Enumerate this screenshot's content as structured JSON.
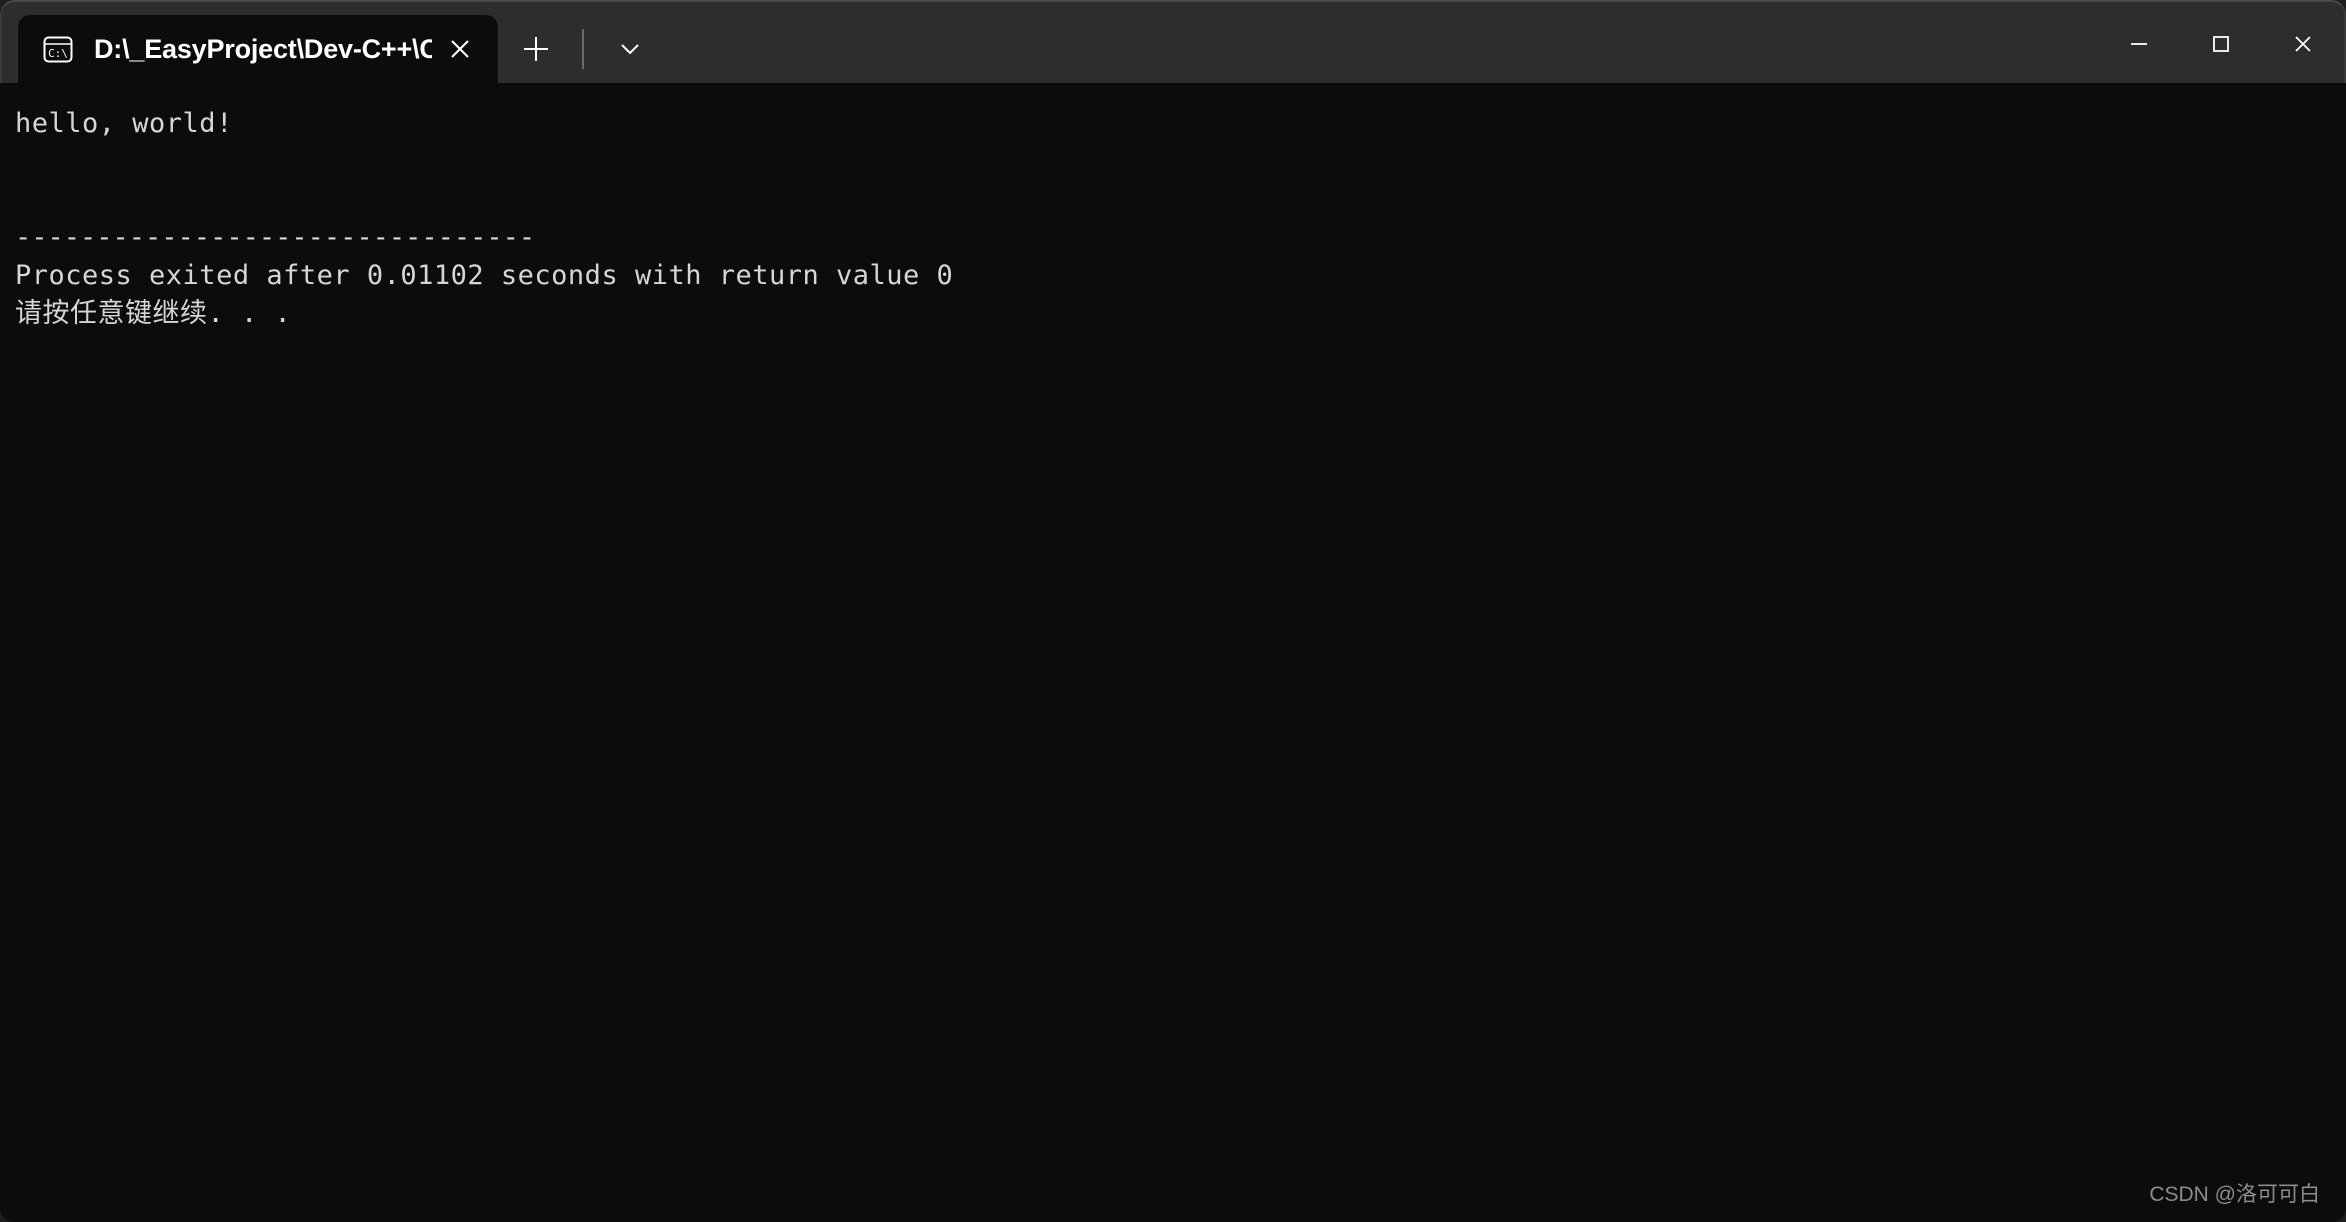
{
  "window": {
    "titlebar_color": "#2d2d2d",
    "body_color": "#0c0c0c",
    "text_color": "#d6d6d6"
  },
  "tabs": [
    {
      "title": "D:\\_EasyProject\\Dev-C++\\Cor",
      "icon": "command-prompt-icon",
      "close_label": "✕",
      "active": true
    }
  ],
  "tab_tools": {
    "new_tab_label": "+",
    "dropdown_label": "ˇ"
  },
  "window_controls": {
    "minimize_label": "—",
    "maximize_label": "□",
    "close_label": "✕"
  },
  "terminal": {
    "lines": [
      "hello, world!",
      "",
      "",
      "--------------------------------",
      "Process exited after 0.01102 seconds with return value 0",
      "请按任意键继续. . ."
    ],
    "output_text": "hello, world!",
    "separator": "--------------------------------",
    "exit_message": "Process exited after 0.01102 seconds with return value 0",
    "exit_seconds": "0.01102",
    "return_value": "0",
    "press_any_key": "请按任意键继续. . ."
  },
  "watermark": {
    "text": "CSDN @洛可可白"
  }
}
